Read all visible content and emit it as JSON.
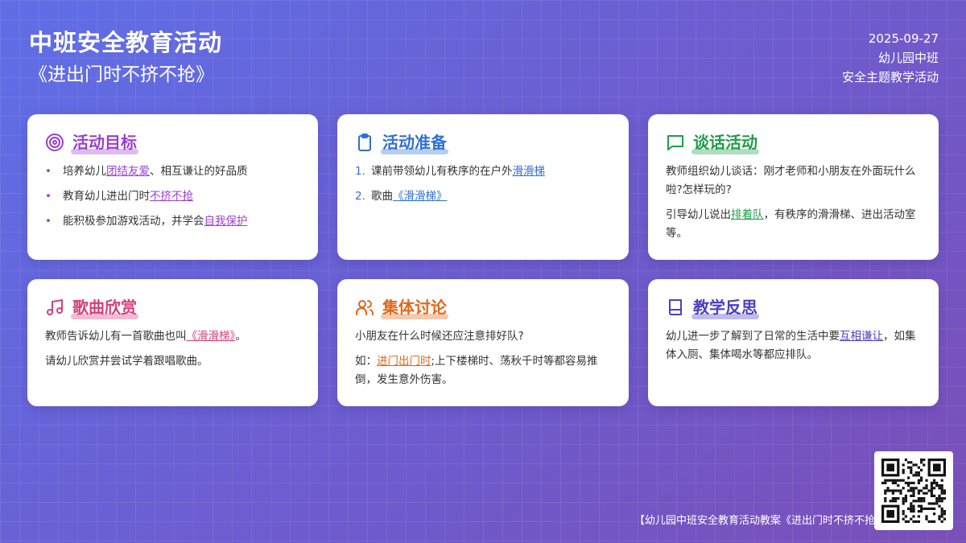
{
  "header": {
    "title": "中班安全教育活动",
    "subtitle": "《进出门时不挤不抢》",
    "date": "2025-09-27",
    "class_name": "幼儿园中班",
    "theme": "安全主题教学活动"
  },
  "cards": {
    "goals": {
      "title": "活动目标",
      "color": "#9b3fd1",
      "items": [
        {
          "pre": "培养幼儿",
          "kw": "团结友爱",
          "post": "、相互谦让的好品质"
        },
        {
          "pre": "教育幼儿进出门时",
          "kw": "不挤不抢",
          "post": ""
        },
        {
          "pre": "能积极参加游戏活动，并学会",
          "kw": "自我保护",
          "post": ""
        }
      ]
    },
    "prep": {
      "title": "活动准备",
      "color": "#2f6fd6",
      "items": [
        {
          "num": "1.",
          "pre": "课前带领幼儿有秩序的在户外",
          "kw": "滑滑梯",
          "post": ""
        },
        {
          "num": "2.",
          "pre": "歌曲",
          "kw": "《滑滑梯》",
          "post": ""
        }
      ]
    },
    "talk": {
      "title": "谈话活动",
      "color": "#1f9d4a",
      "p1": "教师组织幼儿谈话：刚才老师和小朋友在外面玩什么啦?怎样玩的?",
      "p2_pre": "引导幼儿说出",
      "p2_kw": "排着队",
      "p2_post": "，有秩序的滑滑梯、进出活动室等。"
    },
    "song": {
      "title": "歌曲欣赏",
      "color": "#d63f7a",
      "p1_pre": "教师告诉幼儿有一首歌曲也叫",
      "p1_kw": "《滑滑梯》",
      "p1_post": "。",
      "p2": "请幼儿欣赏并尝试学着跟唱歌曲。"
    },
    "discuss": {
      "title": "集体讨论",
      "color": "#e2671a",
      "p1": "小朋友在什么时候还应注意排好队?",
      "p2_pre": "如：",
      "p2_kw": "进门出门时",
      "p2_post": ";上下楼梯时、荡秋千时等都容易推倒，发生意外伤害。"
    },
    "reflect": {
      "title": "教学反思",
      "color": "#4b3fc4",
      "p1_pre": "幼儿进一步了解到了日常的生活中要",
      "p1_kw": "互相谦让",
      "p1_post": "，如集体入厕、集体喝水等都应排队。"
    }
  },
  "footer": {
    "text": "【幼儿园中班安全教育活动教案《进出门时不挤不抢》】"
  },
  "icons": {
    "goals": "target-icon",
    "prep": "clipboard-icon",
    "talk": "chat-bubble-icon",
    "song": "music-note-icon",
    "discuss": "users-icon",
    "reflect": "book-icon",
    "qr": "qr-code-icon"
  }
}
